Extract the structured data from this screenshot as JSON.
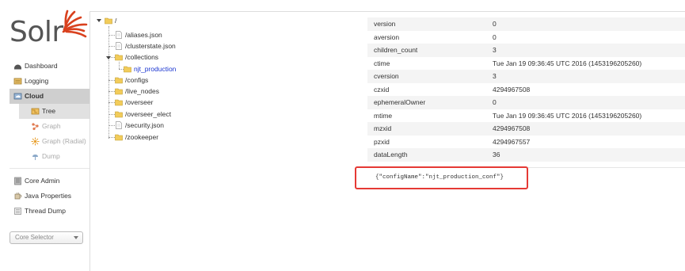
{
  "app": {
    "logo_text": "Solr",
    "accent_color": "#d9411e"
  },
  "sidebar": {
    "items": [
      {
        "label": "Dashboard",
        "icon": "dashboard-icon"
      },
      {
        "label": "Logging",
        "icon": "logging-icon"
      },
      {
        "label": "Cloud",
        "icon": "cloud-icon",
        "active": true
      }
    ],
    "cloud_sub": [
      {
        "label": "Tree",
        "icon": "tree-icon",
        "active": true
      },
      {
        "label": "Graph",
        "icon": "graph-icon"
      },
      {
        "label": "Graph (Radial)",
        "icon": "graph-radial-icon"
      },
      {
        "label": "Dump",
        "icon": "dump-icon"
      }
    ],
    "items2": [
      {
        "label": "Core Admin",
        "icon": "core-admin-icon"
      },
      {
        "label": "Java Properties",
        "icon": "java-properties-icon"
      },
      {
        "label": "Thread Dump",
        "icon": "thread-dump-icon"
      }
    ],
    "core_selector": {
      "placeholder": "Core Selector"
    }
  },
  "tree": {
    "root": "/",
    "nodes": [
      {
        "label": "/aliases.json",
        "type": "file"
      },
      {
        "label": "/clusterstate.json",
        "type": "file"
      },
      {
        "label": "/collections",
        "type": "folder",
        "expanded": true
      },
      {
        "label": "njt_production",
        "type": "folder",
        "selected": true
      },
      {
        "label": "/configs",
        "type": "folder"
      },
      {
        "label": "/live_nodes",
        "type": "folder"
      },
      {
        "label": "/overseer",
        "type": "folder"
      },
      {
        "label": "/overseer_elect",
        "type": "folder"
      },
      {
        "label": "/security.json",
        "type": "file"
      },
      {
        "label": "/zookeeper",
        "type": "folder"
      }
    ]
  },
  "properties": [
    {
      "key": "version",
      "value": "0"
    },
    {
      "key": "aversion",
      "value": "0"
    },
    {
      "key": "children_count",
      "value": "3"
    },
    {
      "key": "ctime",
      "value": "Tue Jan 19 09:36:45 UTC 2016 (1453196205260)"
    },
    {
      "key": "cversion",
      "value": "3"
    },
    {
      "key": "czxid",
      "value": "4294967508"
    },
    {
      "key": "ephemeralOwner",
      "value": "0"
    },
    {
      "key": "mtime",
      "value": "Tue Jan 19 09:36:45 UTC 2016 (1453196205260)"
    },
    {
      "key": "mzxid",
      "value": "4294967508"
    },
    {
      "key": "pzxid",
      "value": "4294967557"
    },
    {
      "key": "dataLength",
      "value": "36"
    }
  ],
  "content": {
    "text": "{\"configName\":\"njt_production_conf\"}"
  },
  "colors": {
    "highlight": "#e53935",
    "selected_link": "#1a35d0",
    "active_nav": "#cfcfcf"
  }
}
